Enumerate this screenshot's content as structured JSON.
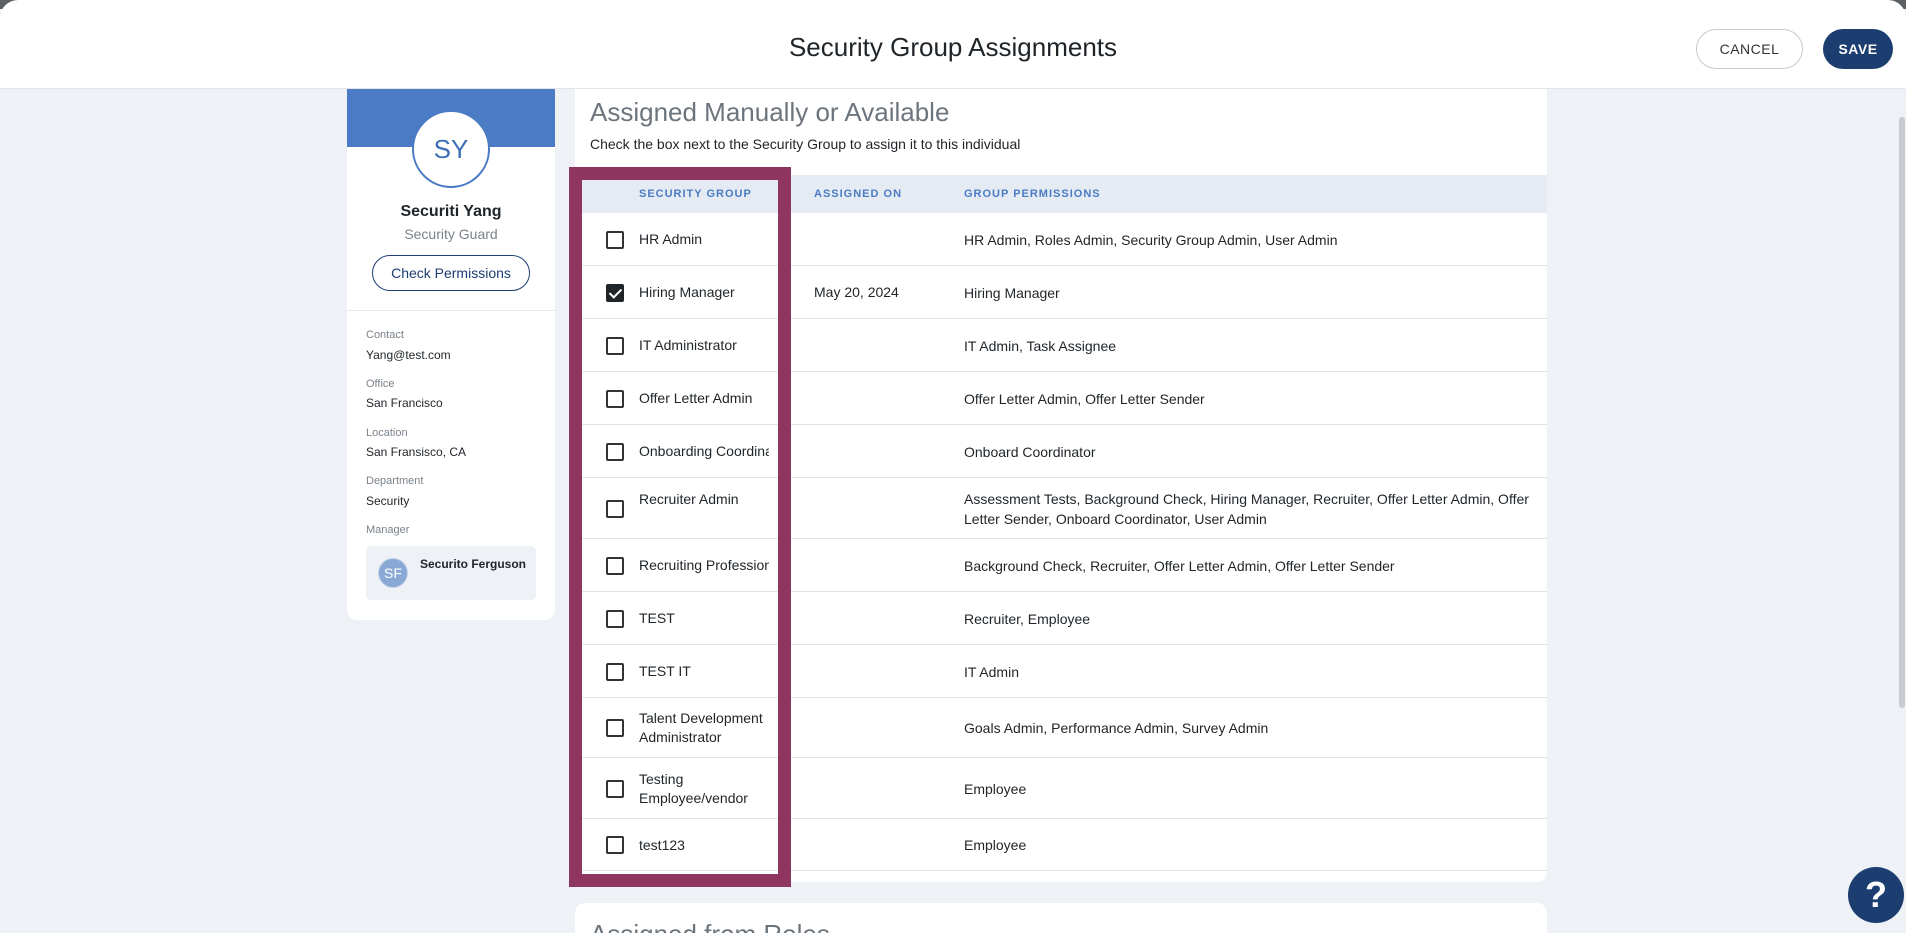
{
  "header": {
    "title": "Security Group Assignments",
    "cancel_label": "CANCEL",
    "save_label": "SAVE"
  },
  "profile": {
    "initials": "SY",
    "name": "Securiti Yang",
    "title": "Security Guard",
    "check_permissions_label": "Check Permissions",
    "contact_label": "Contact",
    "contact_value": "Yang@test.com",
    "office_label": "Office",
    "office_value": "San Francisco",
    "location_label": "Location",
    "location_value": "San Fransisco, CA",
    "department_label": "Department",
    "department_value": "Security",
    "manager_label": "Manager",
    "manager_initials": "SF",
    "manager_name": "Securito Ferguson",
    "banner_color": "#4a7bc4"
  },
  "assigned": {
    "title": "Assigned Manually or Available",
    "subtitle": "Check the box next to the Security Group to assign it to this individual",
    "columns": {
      "group": "SECURITY GROUP",
      "assigned_on": "ASSIGNED ON",
      "permissions": "GROUP PERMISSIONS"
    },
    "rows": [
      {
        "checked": false,
        "group": "HR Admin",
        "assigned_on": "",
        "permissions": "HR Admin, Roles Admin, Security Group Admin, User Admin"
      },
      {
        "checked": true,
        "group": "Hiring Manager",
        "assigned_on": "May 20, 2024",
        "permissions": "Hiring Manager"
      },
      {
        "checked": false,
        "group": "IT Administrator",
        "assigned_on": "",
        "permissions": "IT Admin, Task Assignee"
      },
      {
        "checked": false,
        "group": "Offer Letter Admin",
        "assigned_on": "",
        "permissions": "Offer Letter Admin, Offer Letter Sender"
      },
      {
        "checked": false,
        "group": "Onboarding Coordinator",
        "assigned_on": "",
        "permissions": "Onboard Coordinator"
      },
      {
        "checked": false,
        "group": "Recruiter Admin",
        "assigned_on": "",
        "permissions": "Assessment Tests, Background Check, Hiring Manager, Recruiter, Offer Letter Admin, Offer Letter Sender, Onboard Coordinator, User Admin"
      },
      {
        "checked": false,
        "group": "Recruiting Professional",
        "assigned_on": "",
        "permissions": "Background Check, Recruiter, Offer Letter Admin, Offer Letter Sender"
      },
      {
        "checked": false,
        "group": "TEST",
        "assigned_on": "",
        "permissions": "Recruiter, Employee"
      },
      {
        "checked": false,
        "group": "TEST IT",
        "assigned_on": "",
        "permissions": "IT Admin"
      },
      {
        "checked": false,
        "group": "Talent Development Administrator",
        "assigned_on": "",
        "permissions": "Goals Admin, Performance Admin, Survey Admin"
      },
      {
        "checked": false,
        "group": "Testing Employee/vendor",
        "assigned_on": "",
        "permissions": "Employee"
      },
      {
        "checked": false,
        "group": "test123",
        "assigned_on": "",
        "permissions": "Employee"
      }
    ]
  },
  "next_section": {
    "title": "Assigned from Roles"
  },
  "help": {
    "label": "?"
  },
  "colors": {
    "primary": "#1c3d70",
    "accent": "#4a7bc4",
    "highlight": "#8e3560"
  }
}
